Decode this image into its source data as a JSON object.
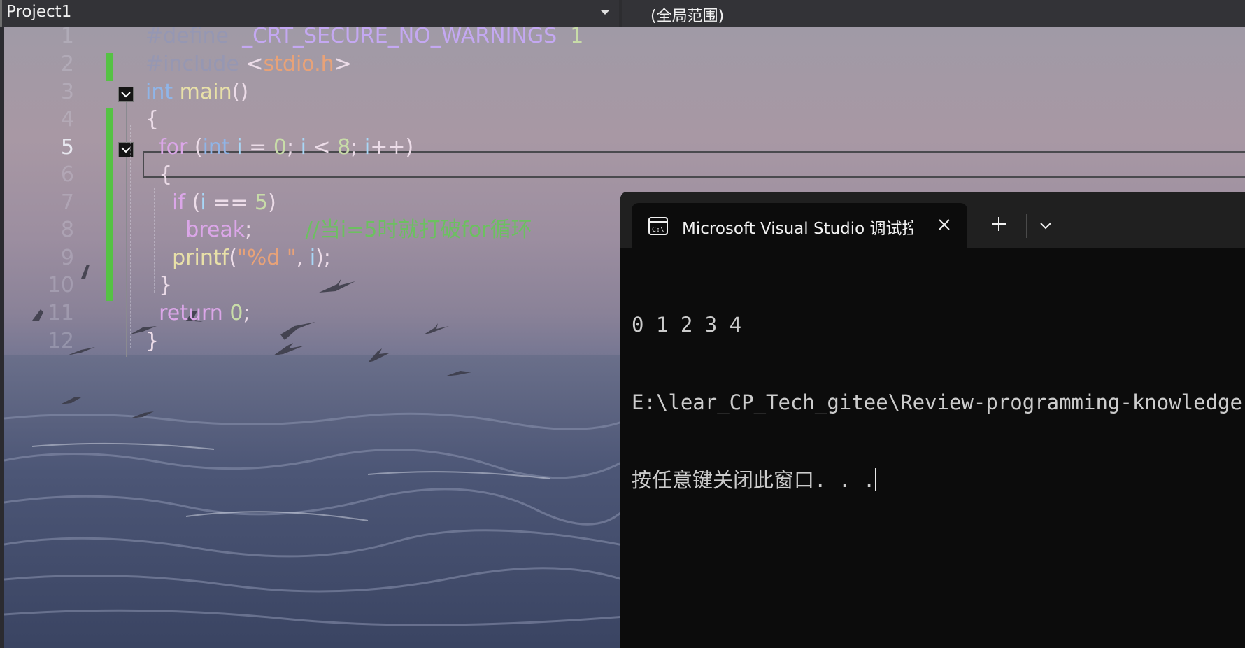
{
  "navbar": {
    "project": "Project1",
    "scope": "(全局范围)"
  },
  "editor": {
    "current_line": "5",
    "line_numbers": [
      "1",
      "2",
      "3",
      "4",
      "5",
      "6",
      "7",
      "8",
      "9",
      "10",
      "11",
      "12"
    ],
    "code": {
      "l1": {
        "directive": "#define",
        "macro": "_CRT_SECURE_NO_WARNINGS",
        "value": "1"
      },
      "l2": {
        "directive": "#include",
        "open": "<",
        "header": "stdio.h",
        "close": ">"
      },
      "l3": {
        "type": "int",
        "name": "main",
        "parens": "()"
      },
      "l4": {
        "brace": "{"
      },
      "l5": {
        "kw": "for",
        "p1": "(",
        "type": "int",
        "var1": "i",
        "eq": "=",
        "zero": "0",
        "semi1": ";",
        "var2": "i",
        "lt": "<",
        "eight": "8",
        "semi2": ";",
        "var3": "i",
        "inc": "++",
        "p2": ")"
      },
      "l6": {
        "brace": "{"
      },
      "l7": {
        "kw": "if",
        "p1": "(",
        "var": "i",
        "op": "==",
        "num": "5",
        "p2": ")"
      },
      "l8": {
        "kw": "break",
        "semi": ";",
        "comment": "//当i=5时就打破for循环"
      },
      "l9": {
        "fn": "printf",
        "p1": "(",
        "str": "\"%d \"",
        "comma": ",",
        "var": "i",
        "p2": ")",
        "semi": ";"
      },
      "l10": {
        "brace": "}"
      },
      "l11": {
        "kw": "return",
        "num": "0",
        "semi": ";"
      },
      "l12": {
        "brace": "}"
      }
    }
  },
  "console": {
    "tab_title": "Microsoft Visual Studio 调试控制台",
    "lines": [
      "0 1 2 3 4",
      "E:\\lear_CP_Tech_gitee\\Review-programming-knowledge",
      "按任意键关闭此窗口. . ."
    ]
  },
  "icons": {
    "console": "terminal-icon",
    "close": "close-icon",
    "new_tab": "plus-icon",
    "dropdown": "chevron-down-icon",
    "fold": "collapse-icon"
  },
  "colors": {
    "change_bar": "#55c244",
    "console_bg": "#0c0c0c",
    "tabbar_bg": "#202020"
  }
}
